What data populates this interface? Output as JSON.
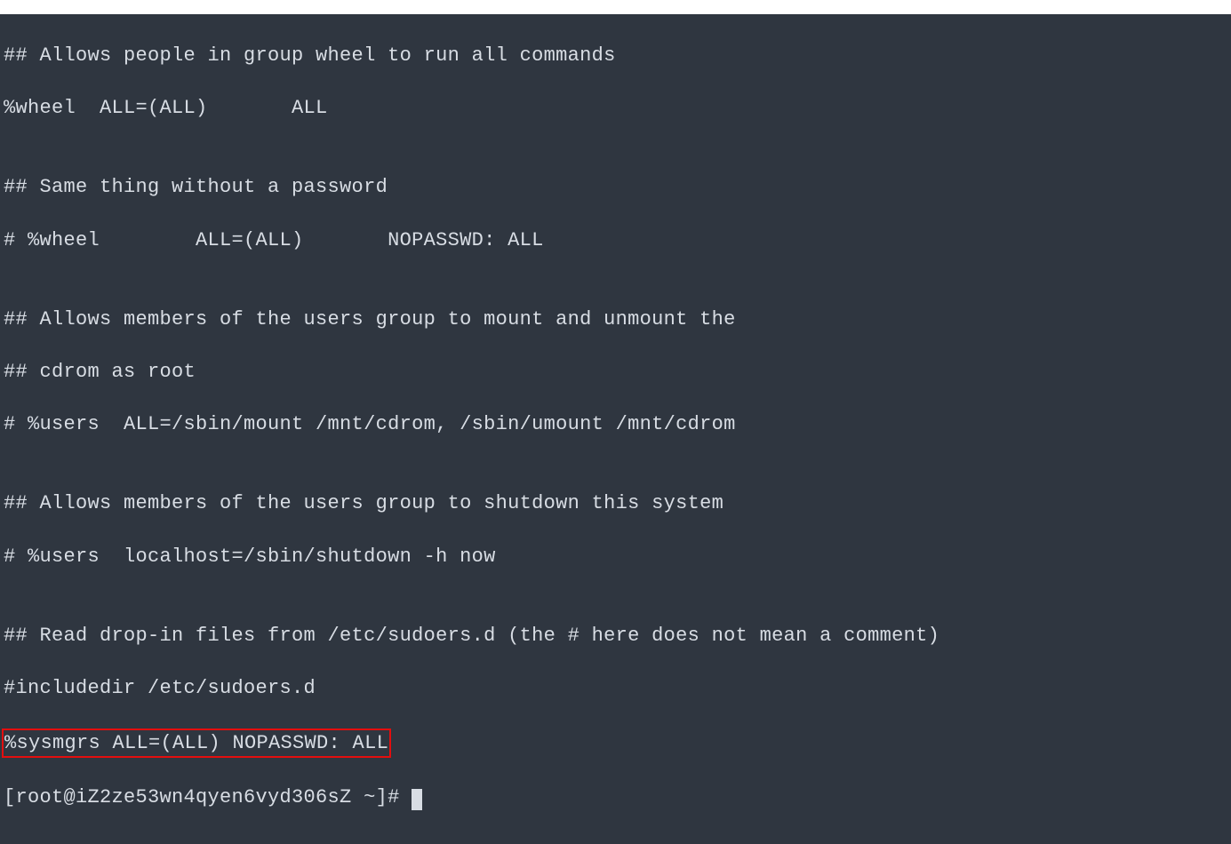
{
  "terminal": {
    "lines": {
      "l1": "## Allows people in group wheel to run all commands",
      "l2": "%wheel  ALL=(ALL)       ALL",
      "l3": "",
      "l4": "## Same thing without a password",
      "l5": "# %wheel        ALL=(ALL)       NOPASSWD: ALL",
      "l6": "",
      "l7": "## Allows members of the users group to mount and unmount the",
      "l8": "## cdrom as root",
      "l9": "# %users  ALL=/sbin/mount /mnt/cdrom, /sbin/umount /mnt/cdrom",
      "l10": "",
      "l11": "## Allows members of the users group to shutdown this system",
      "l12": "# %users  localhost=/sbin/shutdown -h now",
      "l13": "",
      "l14": "## Read drop-in files from /etc/sudoers.d (the # here does not mean a comment)",
      "l15": "#includedir /etc/sudoers.d",
      "l16": "%sysmgrs ALL=(ALL) NOPASSWD: ALL",
      "prompt": "[root@iZ2ze53wn4qyen6vyd306sZ ~]# "
    }
  }
}
